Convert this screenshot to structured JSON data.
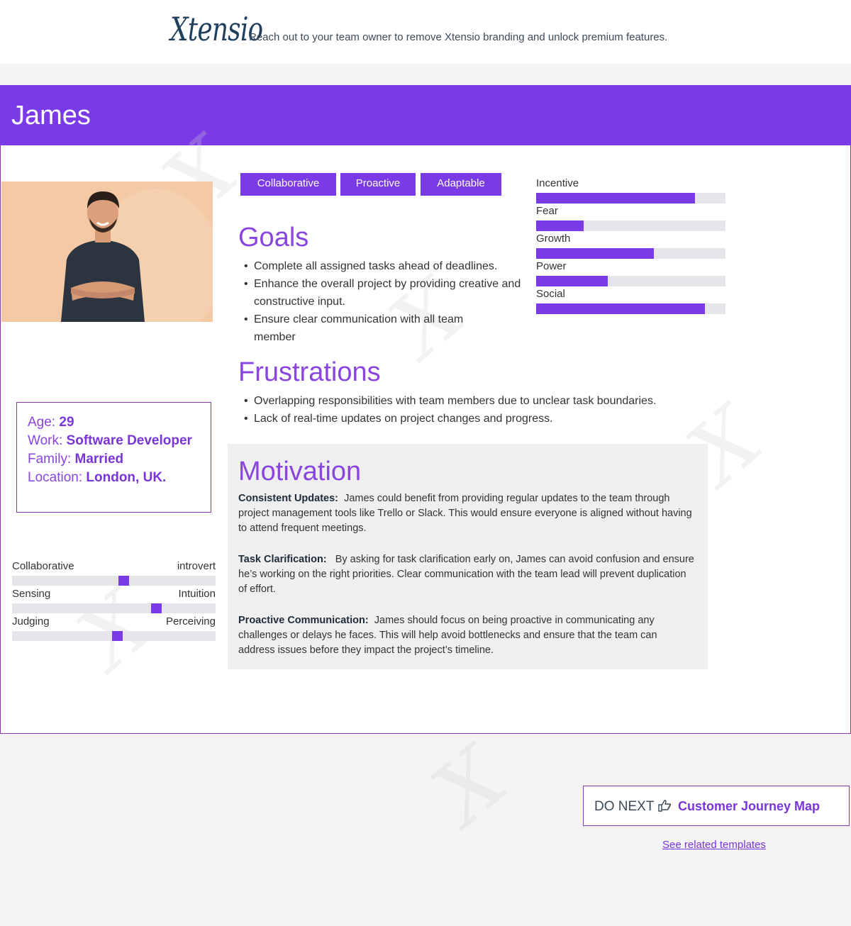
{
  "header": {
    "logo_text": "Xtensio",
    "promo": "Reach out to your team owner to remove Xtensio branding and unlock premium features."
  },
  "persona": {
    "name": "James",
    "photo_alt": "portrait-photo",
    "tags": [
      "Collaborative",
      "Proactive",
      "Adaptable"
    ],
    "facts": [
      {
        "label": "Age:",
        "value": "29"
      },
      {
        "label": "Work:",
        "value": "Software Developer"
      },
      {
        "label": "Family:",
        "value": "Married"
      },
      {
        "label": "Location:",
        "value": "London, UK."
      }
    ],
    "traits": [
      {
        "left": "Collaborative",
        "right": "introvert",
        "level": 0.55
      },
      {
        "left": "Sensing",
        "right": "Intuition",
        "level": 0.72
      },
      {
        "left": "Judging",
        "right": "Perceiving",
        "level": 0.52
      }
    ],
    "drivers": [
      {
        "label": "Incentive",
        "level": 0.84
      },
      {
        "label": "Fear",
        "level": 0.25
      },
      {
        "label": "Growth",
        "level": 0.62
      },
      {
        "label": "Power",
        "level": 0.38
      },
      {
        "label": "Social",
        "level": 0.89
      }
    ],
    "goals": {
      "title": "Goals",
      "items": [
        "Complete all assigned tasks ahead of deadlines.",
        "Enhance the overall project by providing creative and constructive input.",
        "Ensure clear communication with all team member"
      ]
    },
    "frustrations": {
      "title": "Frustrations",
      "items": [
        "Overlapping responsibilities with team members due to unclear task boundaries.",
        "Lack of real-time updates on project changes and progress."
      ]
    },
    "motivation": {
      "title": "Motivation",
      "paragraphs": [
        {
          "lead": "Consistent Updates:",
          "text": "James could benefit from providing regular updates to the team through project management tools like Trello or Slack. This would ensure everyone is aligned without having to attend frequent meetings."
        },
        {
          "lead": "Task Clarification:",
          "text": "By asking for task clarification early on, James can avoid confusion and ensure he’s working on the right priorities. Clear communication with the team lead will prevent duplication of effort."
        },
        {
          "lead": "Proactive Communication:",
          "text": "James should focus on being proactive in communicating any challenges or delays he faces. This will help avoid bottlenecks and ensure that the team can address issues before they impact the project’s timeline."
        }
      ]
    }
  },
  "footer": {
    "do_next_label": "DO NEXT",
    "do_next_icon": "pointing-hand-icon",
    "next_link": "Customer Journey Map",
    "related_link": "See related templates"
  },
  "colors": {
    "accent": "#7a3ae6",
    "border": "#8a3ab0",
    "text": "#333333",
    "motivation_bg": "#efefef"
  }
}
